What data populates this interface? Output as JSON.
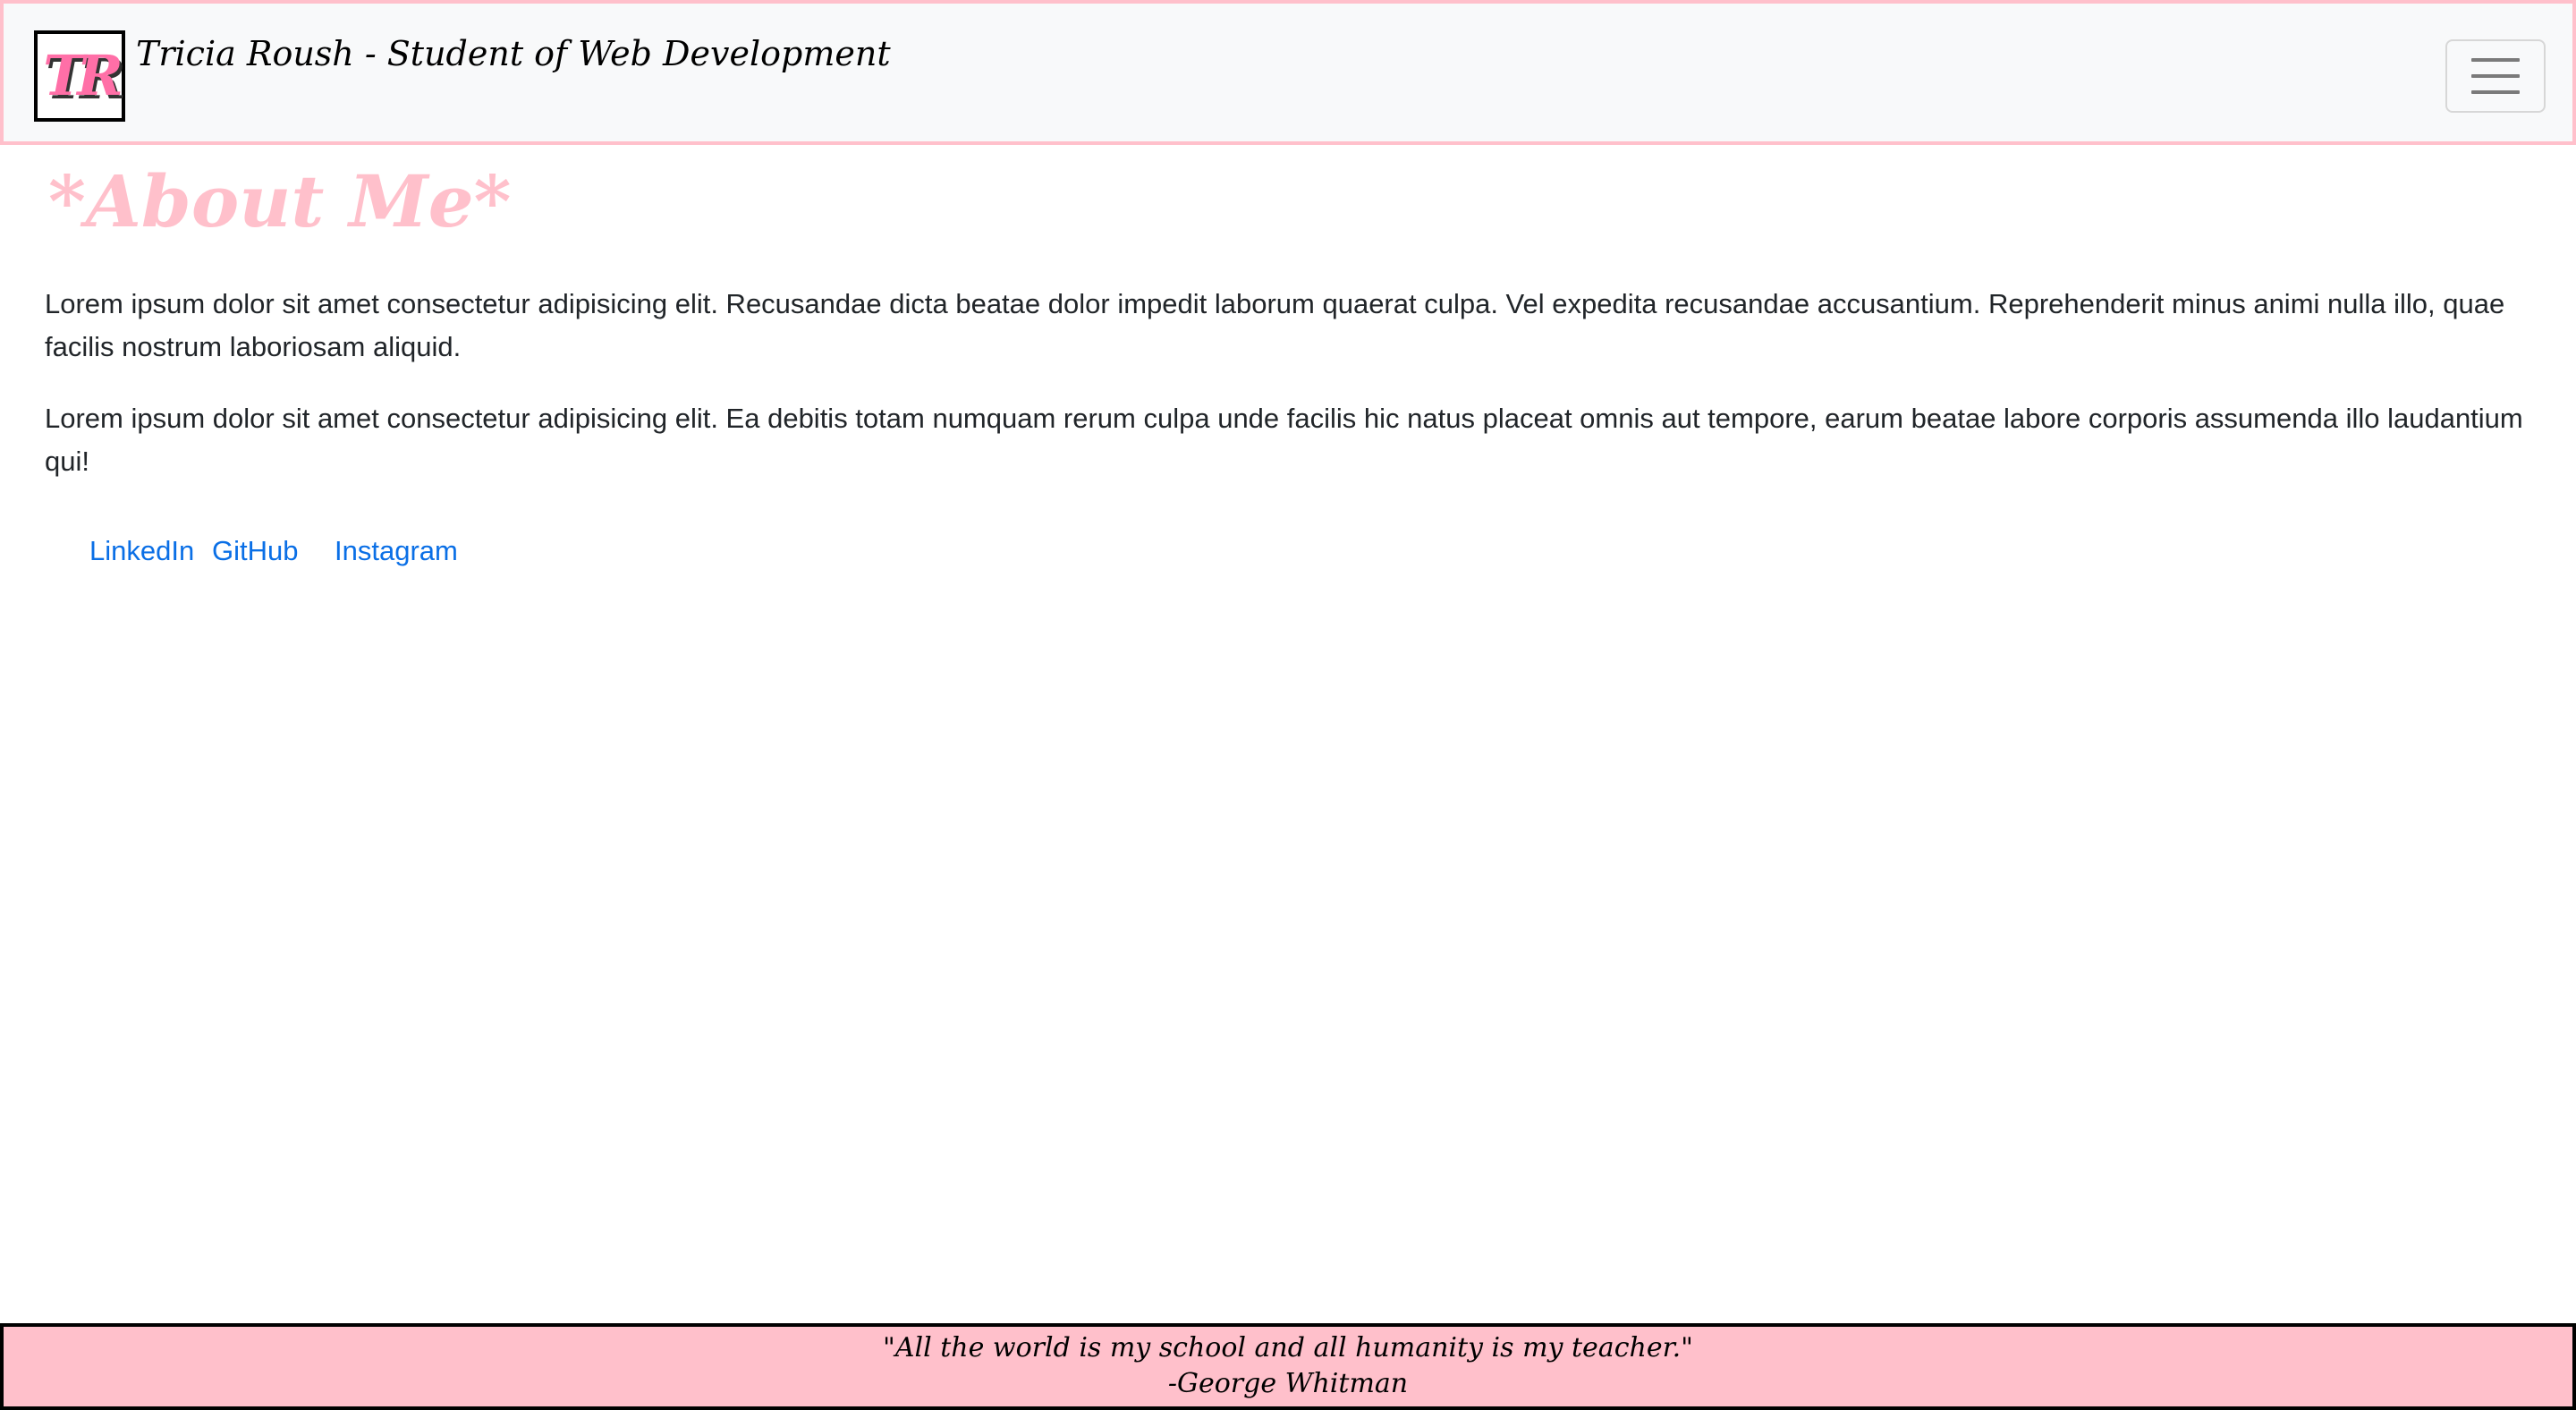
{
  "navbar": {
    "logo_text": "TR",
    "brand": "Tricia Roush - Student of Web Development",
    "toggler_icon": "hamburger-menu-icon"
  },
  "main": {
    "heading": "*About Me*",
    "paragraphs": [
      "Lorem ipsum dolor sit amet consectetur adipisicing elit. Recusandae dicta beatae dolor impedit laborum quaerat culpa. Vel expedita recusandae accusantium. Reprehenderit minus animi nulla illo, quae facilis nostrum laboriosam aliquid.",
      "Lorem ipsum dolor sit amet consectetur adipisicing elit. Ea debitis totam numquam rerum culpa unde facilis hic natus placeat omnis aut tempore, earum beatae labore corporis assumenda illo laudantium qui!"
    ],
    "links": [
      {
        "label": "LinkedIn"
      },
      {
        "label": "GitHub"
      },
      {
        "label": "Instagram"
      }
    ]
  },
  "footer": {
    "quote": "\"All the world is my school and all humanity is my teacher.\"",
    "author": "-George Whitman"
  },
  "colors": {
    "accent_pink": "#ffc0cb",
    "logo_pink": "#ff6fa7",
    "link_blue": "#0a6fe6",
    "navbar_bg": "#f8f9fa"
  }
}
